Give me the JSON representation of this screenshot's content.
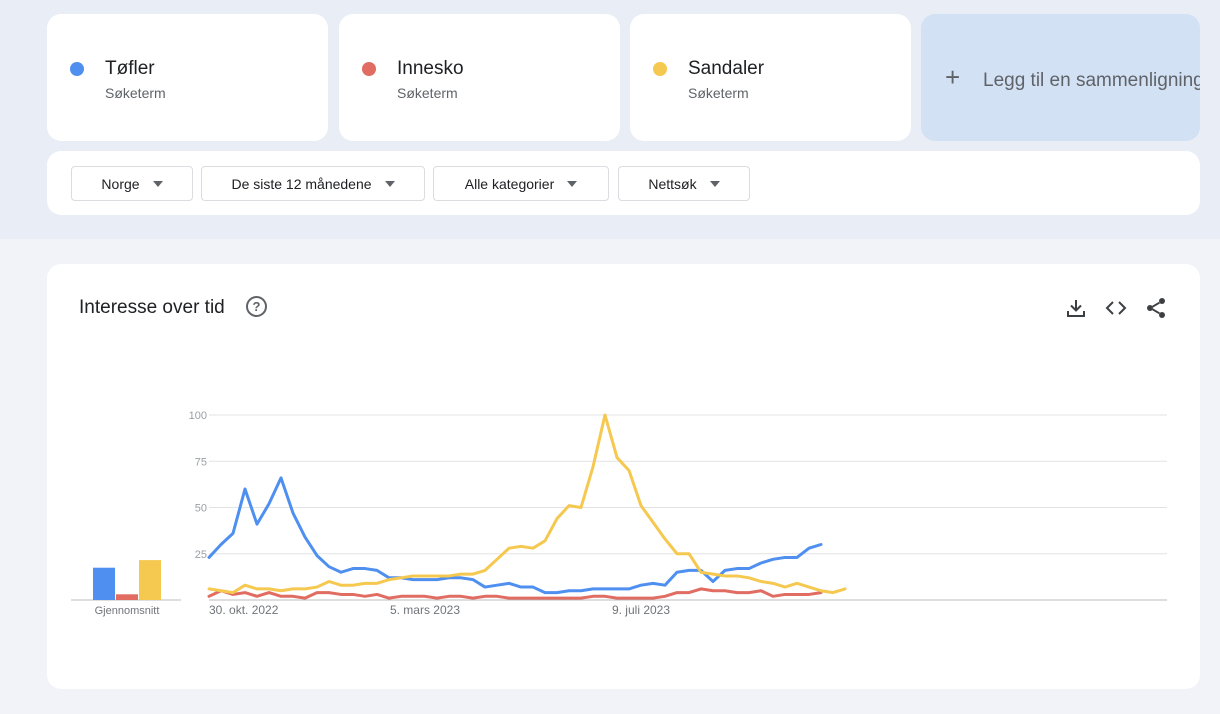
{
  "terms": [
    {
      "name": "Tøfler",
      "sub": "Søketerm",
      "color": "#4e8ff0"
    },
    {
      "name": "Innesko",
      "sub": "Søketerm",
      "color": "#e06c62"
    },
    {
      "name": "Sandaler",
      "sub": "Søketerm",
      "color": "#f5c84f"
    }
  ],
  "add_compare": {
    "plus": "+",
    "label": "Legg til en sammenligning"
  },
  "filters": [
    "Norge",
    "De siste 12 månedene",
    "Alle kategorier",
    "Nettsøk"
  ],
  "chart_card": {
    "title": "Interesse over tid",
    "help_glyph": "?",
    "icons": [
      "download-icon",
      "embed-icon",
      "share-icon"
    ]
  },
  "chart_data": {
    "type": "line",
    "ylim": [
      0,
      100
    ],
    "yticks": [
      25,
      50,
      75,
      100
    ],
    "xtick_labels": [
      {
        "index": 0,
        "label": "30. okt. 2022"
      },
      {
        "index": 18,
        "label": "5. mars 2023"
      },
      {
        "index": 36,
        "label": "9. juli 2023"
      }
    ],
    "grid": true,
    "average_label": "Gjennomsnitt",
    "averages": [
      {
        "name": "Tøfler",
        "value": 17
      },
      {
        "name": "Innesko",
        "value": 3
      },
      {
        "name": "Sandaler",
        "value": 21
      }
    ],
    "series": [
      {
        "name": "Tøfler",
        "color": "#4e8ff0",
        "values": [
          23,
          30,
          36,
          60,
          41,
          52,
          66,
          47,
          34,
          24,
          18,
          15,
          17,
          17,
          16,
          12,
          12,
          11,
          11,
          11,
          12,
          12,
          11,
          7,
          8,
          9,
          7,
          7,
          4,
          4,
          5,
          5,
          6,
          6,
          6,
          6,
          8,
          9,
          8,
          15,
          16,
          16,
          10,
          16,
          17,
          17,
          20,
          22,
          23,
          23,
          28,
          30
        ]
      },
      {
        "name": "Innesko",
        "color": "#e06c62",
        "values": [
          2,
          5,
          3,
          4,
          2,
          4,
          2,
          2,
          1,
          4,
          4,
          3,
          3,
          2,
          3,
          1,
          2,
          2,
          2,
          1,
          2,
          2,
          1,
          2,
          2,
          1,
          1,
          1,
          1,
          1,
          1,
          1,
          2,
          2,
          1,
          1,
          1,
          1,
          2,
          4,
          4,
          6,
          5,
          5,
          4,
          4,
          5,
          2,
          3,
          3,
          3,
          4
        ]
      },
      {
        "name": "Sandaler",
        "color": "#f5c84f",
        "values": [
          6,
          5,
          4,
          8,
          6,
          6,
          5,
          6,
          6,
          7,
          10,
          8,
          8,
          9,
          9,
          11,
          12,
          13,
          13,
          13,
          13,
          14,
          14,
          16,
          22,
          28,
          29,
          28,
          32,
          44,
          51,
          50,
          72,
          100,
          77,
          70,
          51,
          42,
          33,
          25,
          25,
          15,
          14,
          13,
          13,
          12,
          10,
          9,
          7,
          9,
          7,
          5,
          4,
          6
        ]
      }
    ]
  }
}
